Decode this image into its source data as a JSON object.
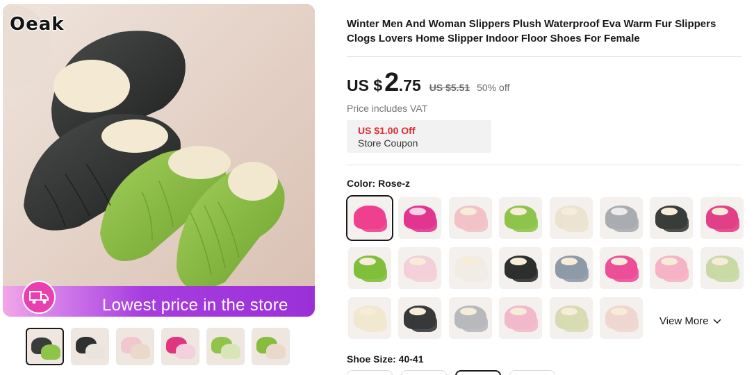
{
  "gallery": {
    "brand": "Oeak",
    "banner_text": "Lowest price in the store",
    "thumbnails": [
      {
        "icon": "thumb-black-green",
        "active": true
      },
      {
        "icon": "thumb-black-white",
        "active": false
      },
      {
        "icon": "thumb-pink-stack",
        "active": false
      },
      {
        "icon": "thumb-rose-detail",
        "active": false
      },
      {
        "icon": "thumb-green-sole",
        "active": false
      },
      {
        "icon": "thumb-green-pair",
        "active": false
      }
    ]
  },
  "product": {
    "title": "Winter Men And Woman Slippers Plush Waterproof Eva Warm Fur Slippers Clogs Lovers Home Slipper Indoor Floor Shoes For Female"
  },
  "price": {
    "prefix": "US $",
    "integer": "2",
    "decimal": ".75",
    "original": "US $5.51",
    "discount": "50% off",
    "vat_note": "Price includes VAT"
  },
  "coupon": {
    "value": "US $1.00 Off",
    "label": "Store Coupon"
  },
  "color": {
    "label": "Color: Rose-z",
    "selected_index": 0,
    "swatches": [
      {
        "color": "#ef3f8f",
        "lining": "#ef3f8f"
      },
      {
        "color": "#e2358f",
        "lining": "#f7d2e6"
      },
      {
        "color": "#f2c2c8",
        "lining": "#f6ecd8"
      },
      {
        "color": "#8fc44a",
        "lining": "#f6ecd8"
      },
      {
        "color": "#ece3cf",
        "lining": "#f6ecd8"
      },
      {
        "color": "#a9acb0",
        "lining": "#eceaea"
      },
      {
        "color": "#3a3d3b",
        "lining": "#f6ecd8"
      },
      {
        "color": "#e13f86",
        "lining": "#f6ecd8"
      },
      {
        "color": "#7fbf3b",
        "lining": "#f6ecd8"
      },
      {
        "color": "#f3cfd9",
        "lining": "#f6ecd8"
      },
      {
        "color": "#f1ece4",
        "lining": "#f6ecd8"
      },
      {
        "color": "#2e3030",
        "lining": "#f6ecd8"
      },
      {
        "color": "#8f9aa8",
        "lining": "#f6ecd8"
      },
      {
        "color": "#ec4f98",
        "lining": "#f6ecd8"
      },
      {
        "color": "#f6b3c6",
        "lining": "#f6ecd8"
      },
      {
        "color": "#c9d9a5",
        "lining": "#f6ecd8"
      },
      {
        "color": "#f1e8cf",
        "lining": "#f6ecd8"
      },
      {
        "color": "#37393a",
        "lining": "#f6ecd8"
      },
      {
        "color": "#b7b9bc",
        "lining": "#f6ecd8"
      },
      {
        "color": "#f2b8cc",
        "lining": "#f6ecd8"
      },
      {
        "color": "#d7dbb3",
        "lining": "#f6ecd8"
      },
      {
        "color": "#f0d6cf",
        "lining": "#f6ecd8"
      }
    ],
    "view_more": "View More"
  },
  "size": {
    "label": "Shoe Size: 40-41",
    "options_visible": 4,
    "selected_index": 2
  }
}
